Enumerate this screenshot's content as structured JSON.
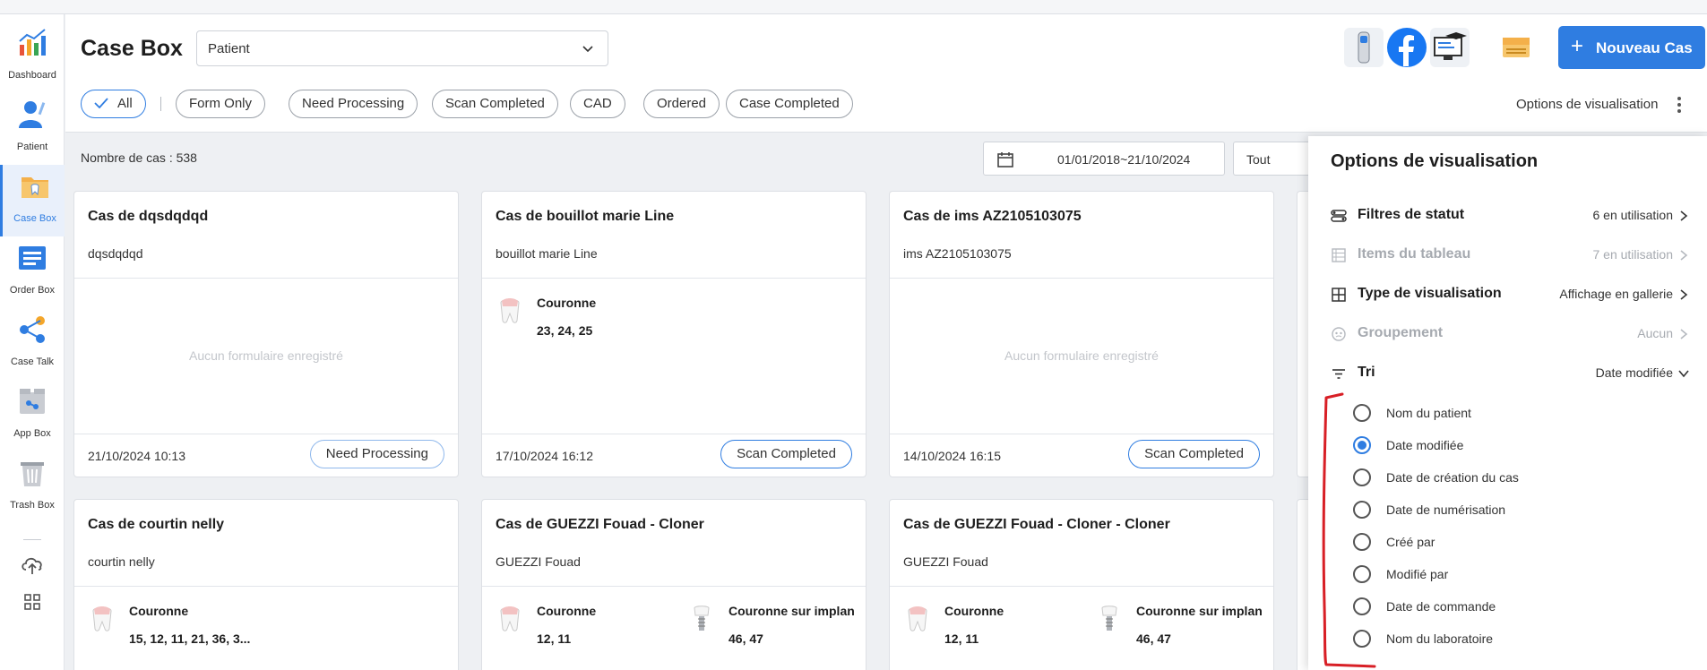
{
  "sidebar": {
    "items": [
      {
        "label": "Dashboard"
      },
      {
        "label": "Patient"
      },
      {
        "label": "Case Box"
      },
      {
        "label": "Order Box"
      },
      {
        "label": "Case Talk"
      },
      {
        "label": "App Box"
      },
      {
        "label": "Trash Box"
      }
    ],
    "active": "Case Box"
  },
  "header": {
    "title": "Case Box",
    "patient_select": "Patient",
    "new_case_label": "Nouveau Cas",
    "view_options_label": "Options de visualisation"
  },
  "filters": {
    "chips": [
      "All",
      "Form Only",
      "Need Processing",
      "Scan Completed",
      "CAD",
      "Ordered",
      "Case Completed"
    ],
    "active": "All"
  },
  "toolbar": {
    "case_count": "Nombre de cas : 538",
    "date_range": "01/01/2018~21/10/2024",
    "filter_value": "Tout"
  },
  "cards": [
    {
      "title": "Cas de dqsdqdqd",
      "patient": "dqsdqdqd",
      "empty": "Aucun formulaire enregistré",
      "date": "21/10/2024 10:13",
      "status": "Need Processing"
    },
    {
      "title": "Cas de bouillot marie Line",
      "patient": "bouillot marie Line",
      "procedures": [
        {
          "name": "Couronne",
          "teeth": "23, 24, 25"
        }
      ],
      "date": "17/10/2024 16:12",
      "status": "Scan Completed"
    },
    {
      "title": "Cas de ims AZ2105103075",
      "patient": "ims AZ2105103075",
      "empty": "Aucun formulaire enregistré",
      "date": "14/10/2024 16:15",
      "status": "Scan Completed"
    },
    {
      "title": "Cas de courtin nelly",
      "patient": "courtin nelly",
      "procedures": [
        {
          "name": "Couronne",
          "teeth": "15, 12, 11, 21, 36, 3..."
        }
      ]
    },
    {
      "title": "Cas de GUEZZI Fouad - Cloner",
      "patient": "GUEZZI Fouad",
      "procedures": [
        {
          "name": "Couronne",
          "teeth": "12, 11"
        },
        {
          "name": "Couronne sur implan",
          "teeth": "46, 47"
        }
      ]
    },
    {
      "title": "Cas de GUEZZI Fouad - Cloner - Cloner",
      "patient": "GUEZZI Fouad",
      "procedures": [
        {
          "name": "Couronne",
          "teeth": "12, 11"
        },
        {
          "name": "Couronne sur implan",
          "teeth": "46, 47"
        }
      ]
    }
  ],
  "panel": {
    "title": "Options de visualisation",
    "options": [
      {
        "label": "Filtres de statut",
        "value": "6 en utilisation",
        "icon": "toggle-filter-icon",
        "enabled": true
      },
      {
        "label": "Items du tableau",
        "value": "7 en utilisation",
        "icon": "table-list-icon",
        "enabled": false
      },
      {
        "label": "Type de visualisation",
        "value": "Affichage en gallerie",
        "icon": "grid-view-icon",
        "enabled": true
      },
      {
        "label": "Groupement",
        "value": "Aucun",
        "icon": "group-icon",
        "enabled": false
      },
      {
        "label": "Tri",
        "value": "Date modifiée",
        "icon": "sort-icon",
        "enabled": true
      }
    ],
    "sort_options": [
      "Nom du patient",
      "Date modifiée",
      "Date de création du cas",
      "Date de numérisation",
      "Créé par",
      "Modifié par",
      "Date de commande",
      "Nom du laboratoire"
    ],
    "sort_selected": "Date modifiée"
  },
  "colors": {
    "accent": "#2f7de1",
    "annotation": "#d81f26"
  }
}
